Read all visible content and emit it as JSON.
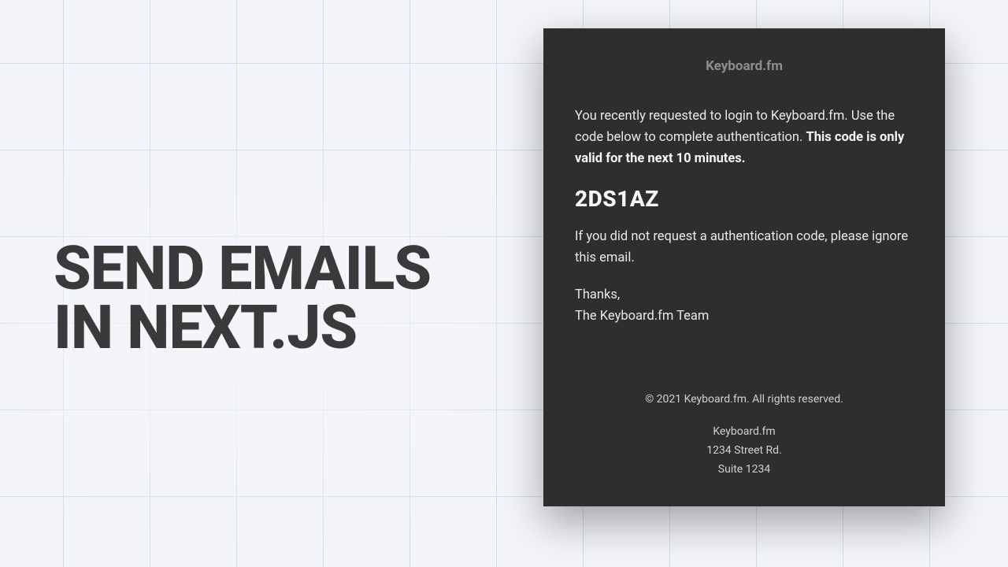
{
  "headline": {
    "line1": "SEND EMAILS",
    "line2": "IN NEXT.JS"
  },
  "email": {
    "brand": "Keyboard.fm",
    "intro_text": "You recently requested to login to Keyboard.fm. Use the code below to complete authentication. ",
    "intro_bold": "This code is only valid for the next 10 minutes.",
    "code": "2DS1AZ",
    "ignore_text": "If you did not request a authentication code, please ignore this email.",
    "thanks": "Thanks,",
    "team": "The Keyboard.fm Team",
    "footer": {
      "copyright": "© 2021 Keyboard.fm. All rights reserved.",
      "company": "Keyboard.fm",
      "street": "1234 Street Rd.",
      "suite": "Suite 1234"
    }
  }
}
